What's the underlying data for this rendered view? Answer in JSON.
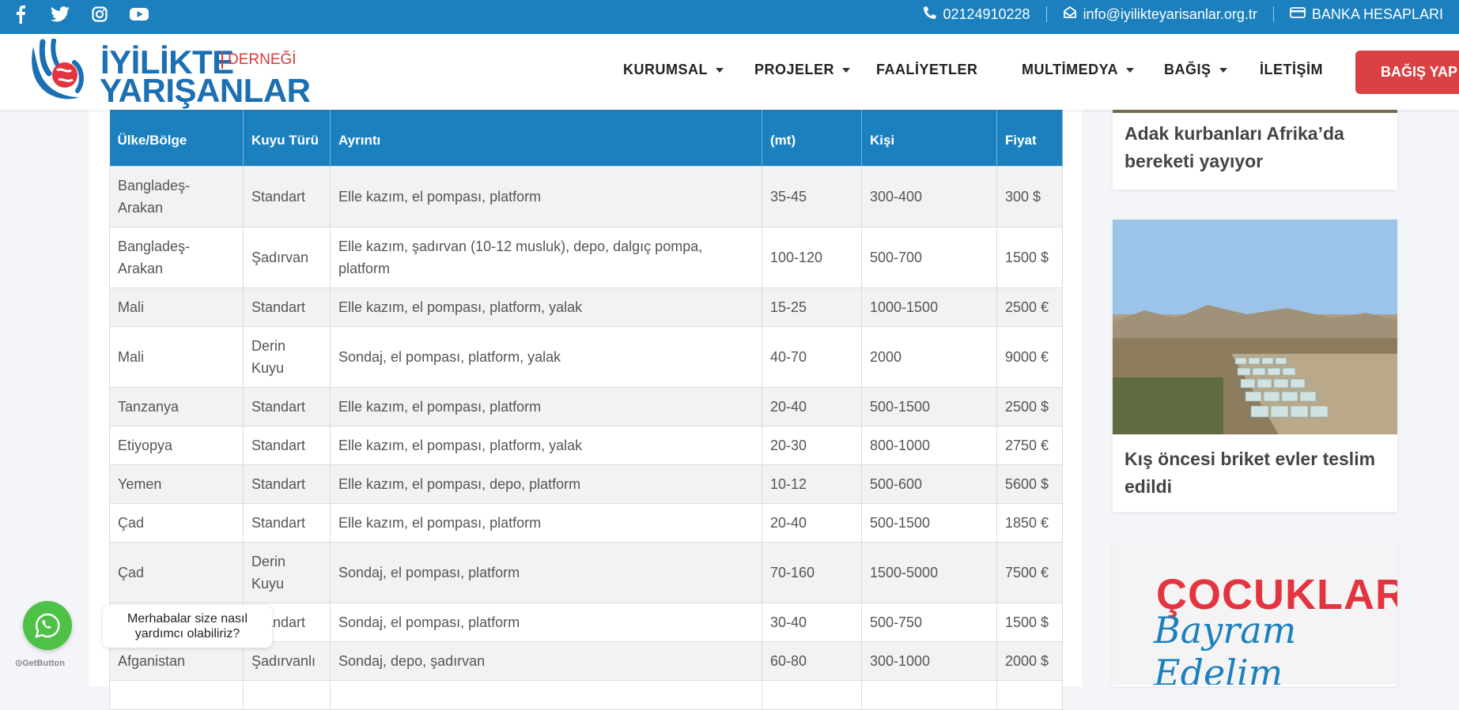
{
  "topbar": {
    "social": [
      "facebook-icon",
      "twitter-icon",
      "instagram-icon",
      "youtube-icon"
    ],
    "phone": "02124910228",
    "email": "info@iyilikteyarisanlar.org.tr",
    "bank": "BANKA HESAPLARI"
  },
  "logo": {
    "line1": "İYİLİKTE",
    "line2": "YARIŞANLAR",
    "badge": "DERNEĞİ"
  },
  "nav": {
    "items": [
      "KURUMSAL",
      "PROJELER",
      "FAALİYETLER",
      "MULTİMEDYA",
      "BAĞIŞ",
      "İLETİŞİM"
    ],
    "donate": "BAĞIŞ YAP"
  },
  "table": {
    "headers": [
      "Ülke/Bölge",
      "Kuyu Türü",
      "Ayrıntı",
      "(mt)",
      "Kişi",
      "Fiyat"
    ],
    "rows": [
      [
        "Bangladeş-Arakan",
        "Standart",
        "Elle kazım, el pompası, platform",
        "35-45",
        "300-400",
        "300 $"
      ],
      [
        "Bangladeş-Arakan",
        "Şadırvan",
        "Elle kazım, şadırvan (10-12 musluk), depo, dalgıç pompa, platform",
        "100-120",
        "500-700",
        "1500 $"
      ],
      [
        "Mali",
        "Standart",
        "Elle kazım, el pompası, platform, yalak",
        "15-25",
        "1000-1500",
        "2500 €"
      ],
      [
        "Mali",
        "Derin Kuyu",
        "Sondaj, el pompası, platform, yalak",
        "40-70",
        "2000",
        "9000 €"
      ],
      [
        "Tanzanya",
        "Standart",
        "Elle kazım, el pompası, platform",
        "20-40",
        "500-1500",
        "2500 $"
      ],
      [
        "Etiyopya",
        "Standart",
        "Elle kazım, el pompası, platform, yalak",
        "20-30",
        "800-1000",
        "2750 €"
      ],
      [
        "Yemen",
        "Standart",
        "Elle kazım, el pompası, depo, platform",
        "10-12",
        "500-600",
        "5600 $"
      ],
      [
        "Çad",
        "Standart",
        "Elle kazım, el pompası, platform",
        "20-40",
        "500-1500",
        "1850 €"
      ],
      [
        "Çad",
        "Derin Kuyu",
        "Sondaj, el pompası, platform",
        "70-160",
        "1500-5000",
        "7500 €"
      ],
      [
        "",
        "Standart",
        "Sondaj, el pompası, platform",
        "30-40",
        "500-750",
        "1500 $"
      ],
      [
        "Afganistan",
        "Şadırvanlı",
        "Sondaj, depo, şadırvan",
        "60-80",
        "300-1000",
        "2000 $"
      ]
    ]
  },
  "sidebar": {
    "card1_title": "Adak kurbanları Afrika’da bereketi yayıyor",
    "card2_title": "Kış öncesi briket evler teslim edildi",
    "poster_line1": "ÇOCUKLARLA",
    "poster_line2": "Bayram Edelim"
  },
  "whatsapp": {
    "message": "Merhabalar size nasıl yardımcı olabiliriz?",
    "brand": "GetButton"
  }
}
